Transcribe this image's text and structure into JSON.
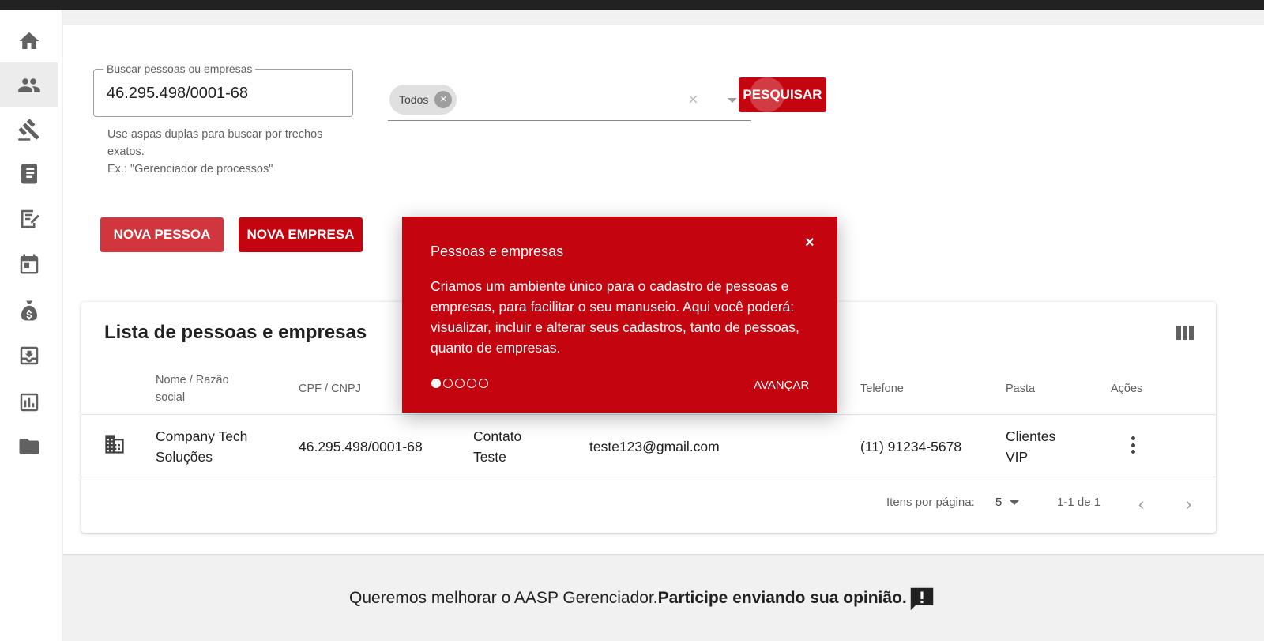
{
  "search": {
    "legend": "Buscar pessoas ou empresas",
    "value": "46.295.498/0001-68",
    "hint_line1": "Use aspas duplas para buscar por trechos exatos.",
    "hint_line2": "Ex.: \"Gerenciador de processos\""
  },
  "filter": {
    "chip": "Todos"
  },
  "buttons": {
    "search": "PESQUISAR",
    "new_person": "NOVA PESSOA",
    "new_company": "NOVA EMPRESA"
  },
  "list": {
    "title": "Lista de pessoas e empresas",
    "headers": {
      "name": "Nome / Razão social",
      "doc": "CPF / CNPJ",
      "phone": "Telefone",
      "folder": "Pasta",
      "actions": "Ações"
    },
    "rows": [
      {
        "name": "Company Tech Soluções",
        "doc": "46.295.498/0001-68",
        "contact": "Contato Teste",
        "email": "teste123@gmail.com",
        "phone": "(11) 91234-5678",
        "folder": "Clientes VIP"
      }
    ],
    "pagination": {
      "label": "Itens por página:",
      "per_page": "5",
      "range": "1-1 de 1"
    }
  },
  "tour": {
    "title": "Pessoas e empresas",
    "close": "×",
    "body": "Criamos um ambiente único para o cadastro de pessoas e empresas, para facilitar o seu manuseio. Aqui você poderá: visualizar, incluir e alterar seus cadastros, tanto de pessoas, quanto de empresas.",
    "next": "AVANÇAR",
    "step": 1,
    "steps": 5
  },
  "footer": {
    "text": "Queremos melhorar o AASP Gerenciador.",
    "bold": "Participe enviando sua opinião."
  },
  "colors": {
    "brand_red": "#c4040f",
    "light_red": "#d1363e"
  }
}
